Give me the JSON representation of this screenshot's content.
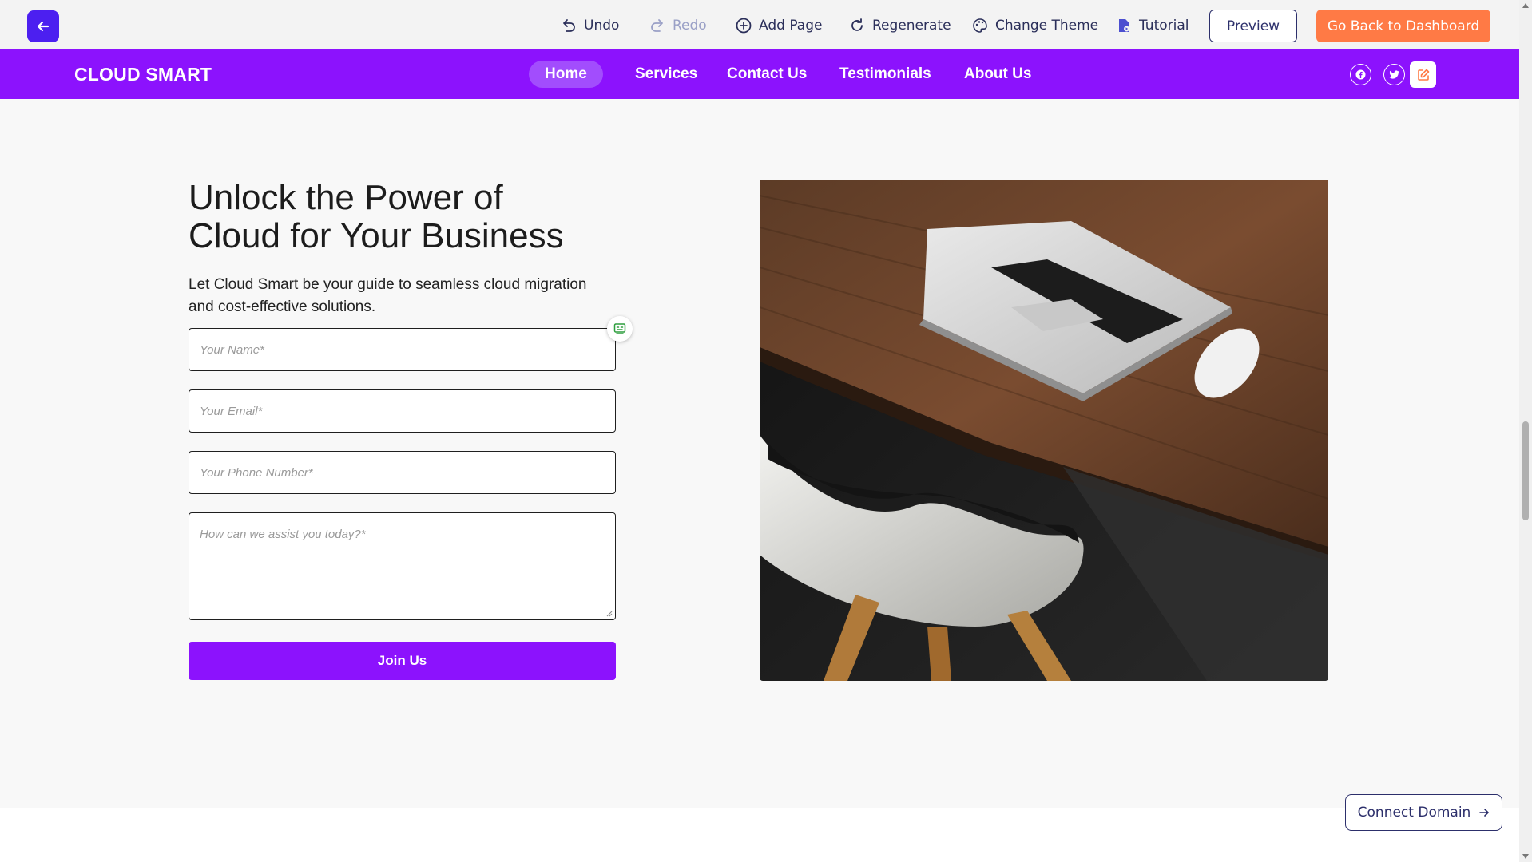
{
  "toolbar": {
    "undo": "Undo",
    "redo": "Redo",
    "add_page": "Add Page",
    "regenerate": "Regenerate",
    "change_theme": "Change Theme",
    "tutorial": "Tutorial",
    "preview": "Preview",
    "dashboard": "Go Back to Dashboard"
  },
  "site": {
    "brand": "CLOUD SMART",
    "nav": [
      "Home",
      "Services",
      "Contact Us",
      "Testimonials",
      "About Us"
    ],
    "active_nav": "Home"
  },
  "hero": {
    "heading_line1": "Unlock the Power of",
    "heading_line2": "Cloud for Your Business",
    "subtext": "Let Cloud Smart be your guide to seamless cloud migration and cost-effective solutions.",
    "fields": {
      "name": "Your Name*",
      "email": "Your Email*",
      "phone": "Your Phone Number*",
      "message": "How can we assist you today?*"
    },
    "button": "Join Us"
  },
  "footer": {
    "connect_domain": "Connect Domain"
  },
  "colors": {
    "brand_purple": "#8c12fd",
    "toolbar_blue": "#4c1ff0",
    "orange": "#ff7a45"
  }
}
